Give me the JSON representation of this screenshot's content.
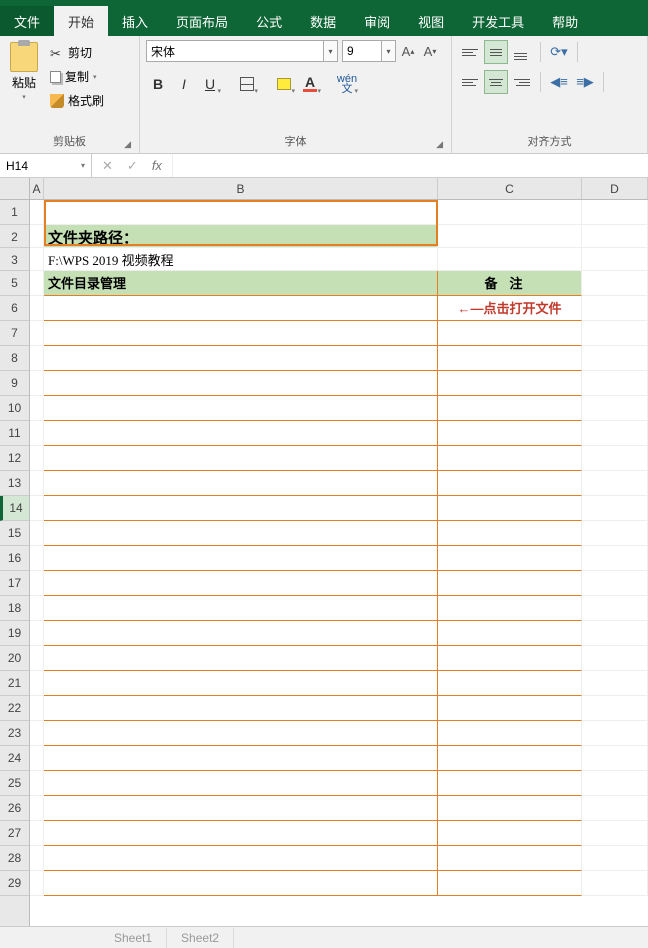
{
  "tabs": {
    "file": "文件",
    "home": "开始",
    "insert": "插入",
    "layout": "页面布局",
    "formula": "公式",
    "data": "数据",
    "review": "审阅",
    "view": "视图",
    "dev": "开发工具",
    "help": "帮助"
  },
  "ribbon": {
    "clipboard": {
      "paste": "粘贴",
      "cut": "剪切",
      "copy": "复制",
      "format": "格式刷",
      "label": "剪贴板"
    },
    "font": {
      "name": "宋体",
      "size": "9",
      "bold": "B",
      "italic": "I",
      "underline": "U",
      "color_letter": "A",
      "wen": "wén\n文",
      "label": "字体"
    },
    "align": {
      "label": "对齐方式"
    }
  },
  "formula_bar": {
    "namebox": "H14",
    "cancel": "✕",
    "confirm": "✓",
    "fx": "fx"
  },
  "columns": [
    "A",
    "B",
    "C",
    "D"
  ],
  "col_widths": {
    "A": 14,
    "B": 394,
    "C": 144,
    "D": 66
  },
  "rows": [
    "1",
    "2",
    "3",
    "5",
    "6",
    "7",
    "8",
    "9",
    "10",
    "11",
    "12",
    "13",
    "14",
    "15",
    "16",
    "17",
    "18",
    "19",
    "20",
    "21",
    "22",
    "23",
    "24",
    "25",
    "26",
    "27",
    "28",
    "29"
  ],
  "cells": {
    "B2": "文件夹路径：",
    "B3": "F:\\WPS 2019 视频教程",
    "B5": "文件目录管理",
    "C5": "备注",
    "C6": "←—点击打开文件"
  },
  "sheet_tabs": [
    "Sheet1",
    "Sheet2"
  ]
}
